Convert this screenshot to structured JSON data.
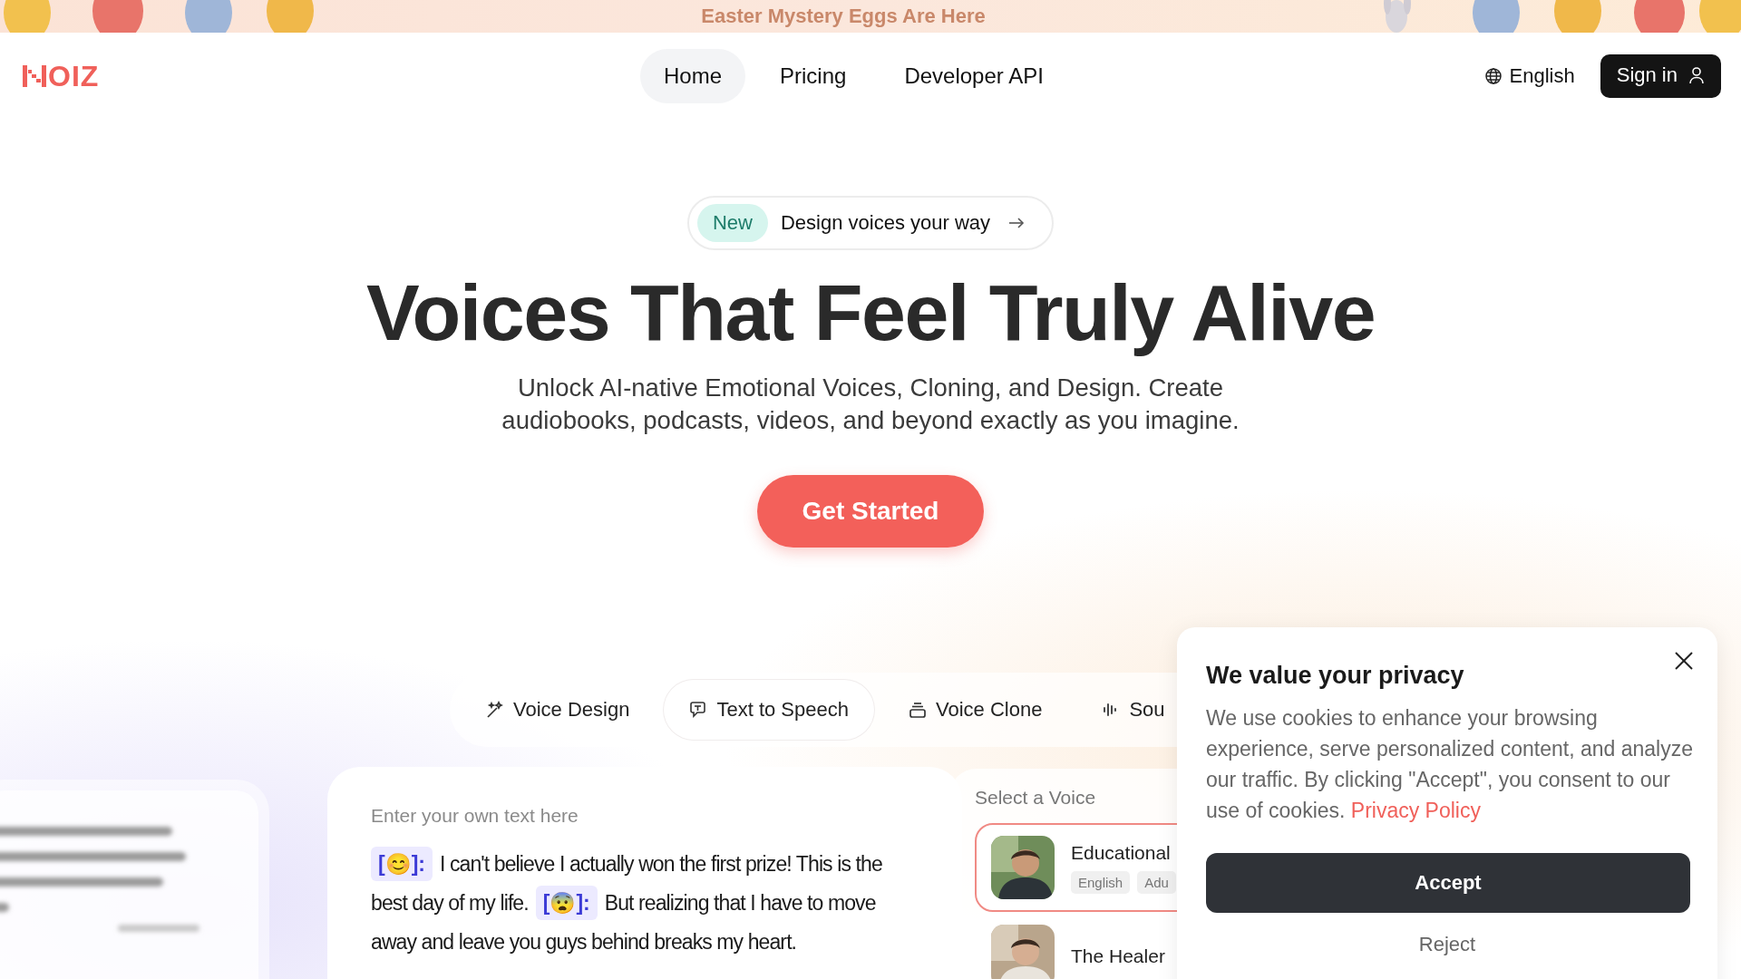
{
  "banner": {
    "title": "Easter Mystery Eggs Are Here"
  },
  "header": {
    "logo": "OIZ",
    "nav": [
      {
        "label": "Home",
        "selected": true
      },
      {
        "label": "Pricing",
        "selected": false
      },
      {
        "label": "Developer API",
        "selected": false
      }
    ],
    "language": "English",
    "sign_in": "Sign in"
  },
  "hero": {
    "badge": {
      "tag": "New",
      "text": "Design voices your way"
    },
    "title": "Voices That Feel Truly Alive",
    "subtitle": "Unlock AI-native Emotional Voices, Cloning, and Design. Create audiobooks, podcasts, videos, and beyond exactly as you imagine.",
    "cta": "Get Started"
  },
  "tabs": [
    {
      "kind": "design",
      "label": "Voice Design",
      "selected": false
    },
    {
      "kind": "speech",
      "label": "Text to Speech",
      "selected": true
    },
    {
      "kind": "clone",
      "label": "Voice Clone",
      "selected": false
    },
    {
      "kind": "sound",
      "label": "Sou",
      "selected": false
    }
  ],
  "editor": {
    "placeholder": "Enter your own text here",
    "segments": [
      {
        "kind": "tag",
        "text": "[😊]:"
      },
      {
        "kind": "text",
        "text": "I can't believe I actually won the first prize! This is the best day of my life."
      },
      {
        "kind": "tag",
        "text": "[😨]:"
      },
      {
        "kind": "text",
        "text": "But realizing that I have to move away and leave you guys behind breaks my heart."
      }
    ]
  },
  "voices": {
    "label": "Select a Voice",
    "items": [
      {
        "name": "Educational",
        "tags": [
          "English",
          "Adu"
        ],
        "selected": true
      },
      {
        "name": "The Healer",
        "selected": false
      }
    ]
  },
  "cookie": {
    "title": "We value your privacy",
    "body": "We use cookies to enhance your browsing experience, serve personalized content, and analyze our traffic. By clicking \"Accept\", you consent to our use of cookies.",
    "link": "Privacy Policy",
    "accept": "Accept",
    "reject": "Reject"
  }
}
